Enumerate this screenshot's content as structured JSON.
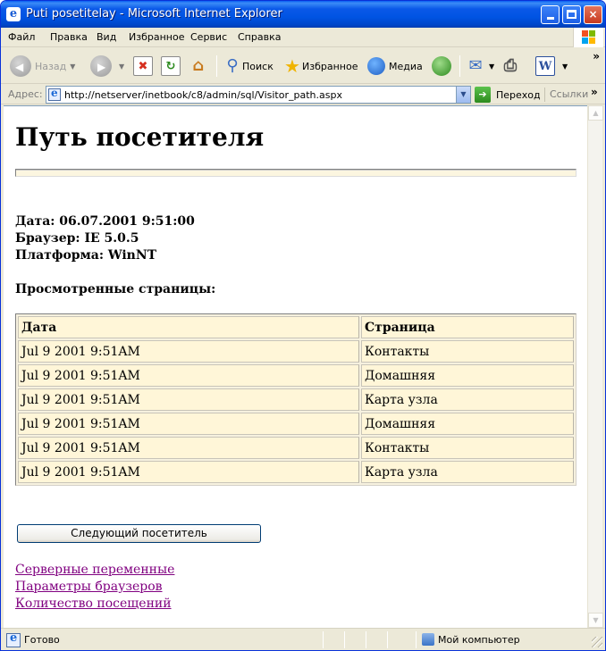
{
  "window": {
    "title": "Puti posetitelay - Microsoft Internet Explorer",
    "app_icon": "ie-icon",
    "controls": {
      "minimize": "minimize-icon",
      "maximize": "maximize-icon",
      "close": "×"
    }
  },
  "menu": {
    "items": [
      "Файл",
      "Правка",
      "Вид",
      "Избранное",
      "Сервис",
      "Справка"
    ]
  },
  "toolbar": {
    "back_label": "Назад",
    "search_label": "Поиск",
    "favorites_label": "Избранное",
    "media_label": "Медиа",
    "more": "»"
  },
  "address": {
    "label": "Адрес:",
    "url": "http://netserver/inetbook/c8/admin/sql/Visitor_path.aspx",
    "go_label": "Переход",
    "links_label": "Ссылки",
    "links_more": "»"
  },
  "page": {
    "heading": "Путь посетителя",
    "date_line": "Дата: 06.07.2001 9:51:00",
    "browser_line": "Браузер: IE 5.0.5",
    "platform_line": "Платформа: WinNT",
    "viewed_heading": "Просмотренные страницы:",
    "table": {
      "headers": [
        "Дата",
        "Страница"
      ],
      "rows": [
        [
          "Jul 9 2001 9:51AM",
          "Контакты"
        ],
        [
          "Jul 9 2001 9:51AM",
          "Домашняя"
        ],
        [
          "Jul 9 2001 9:51AM",
          "Карта узла"
        ],
        [
          "Jul 9 2001 9:51AM",
          "Домашняя"
        ],
        [
          "Jul 9 2001 9:51AM",
          "Контакты"
        ],
        [
          "Jul 9 2001 9:51AM",
          "Карта узла"
        ]
      ]
    },
    "next_button": "Следующий посетитель",
    "links": [
      "Серверные переменные",
      "Параметры браузеров",
      "Количество посещений"
    ]
  },
  "status": {
    "text": "Готово",
    "zone": "Мой компьютер"
  },
  "colors": {
    "title_bar": "#0054e3",
    "table_cell_bg": "#fff6d8",
    "visited_link": "#800080"
  }
}
